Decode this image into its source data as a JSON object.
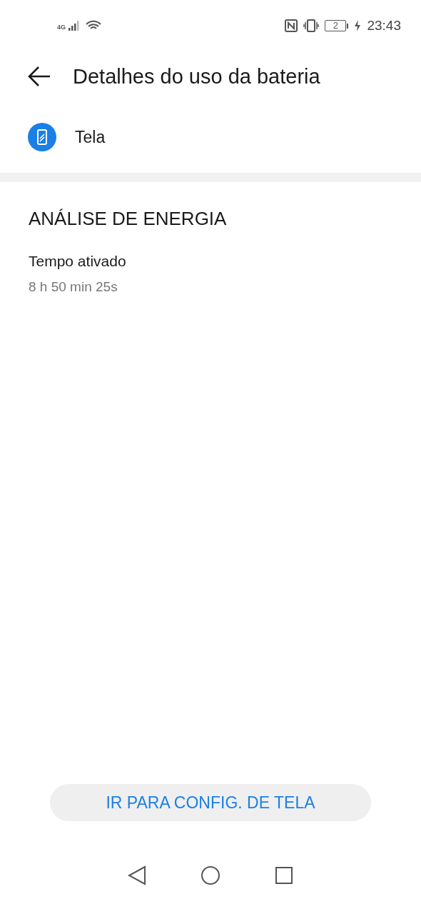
{
  "status_bar": {
    "network_type": "4G",
    "battery_text": "2",
    "time": "23:43"
  },
  "header": {
    "title": "Detalhes do uso da bateria"
  },
  "app": {
    "name": "Tela"
  },
  "section": {
    "title": "ANÁLISE DE ENERGIA",
    "items": [
      {
        "label": "Tempo ativado",
        "value": "8 h 50 min 25s"
      }
    ]
  },
  "action_button": {
    "label": "IR PARA CONFIG. DE TELA"
  }
}
